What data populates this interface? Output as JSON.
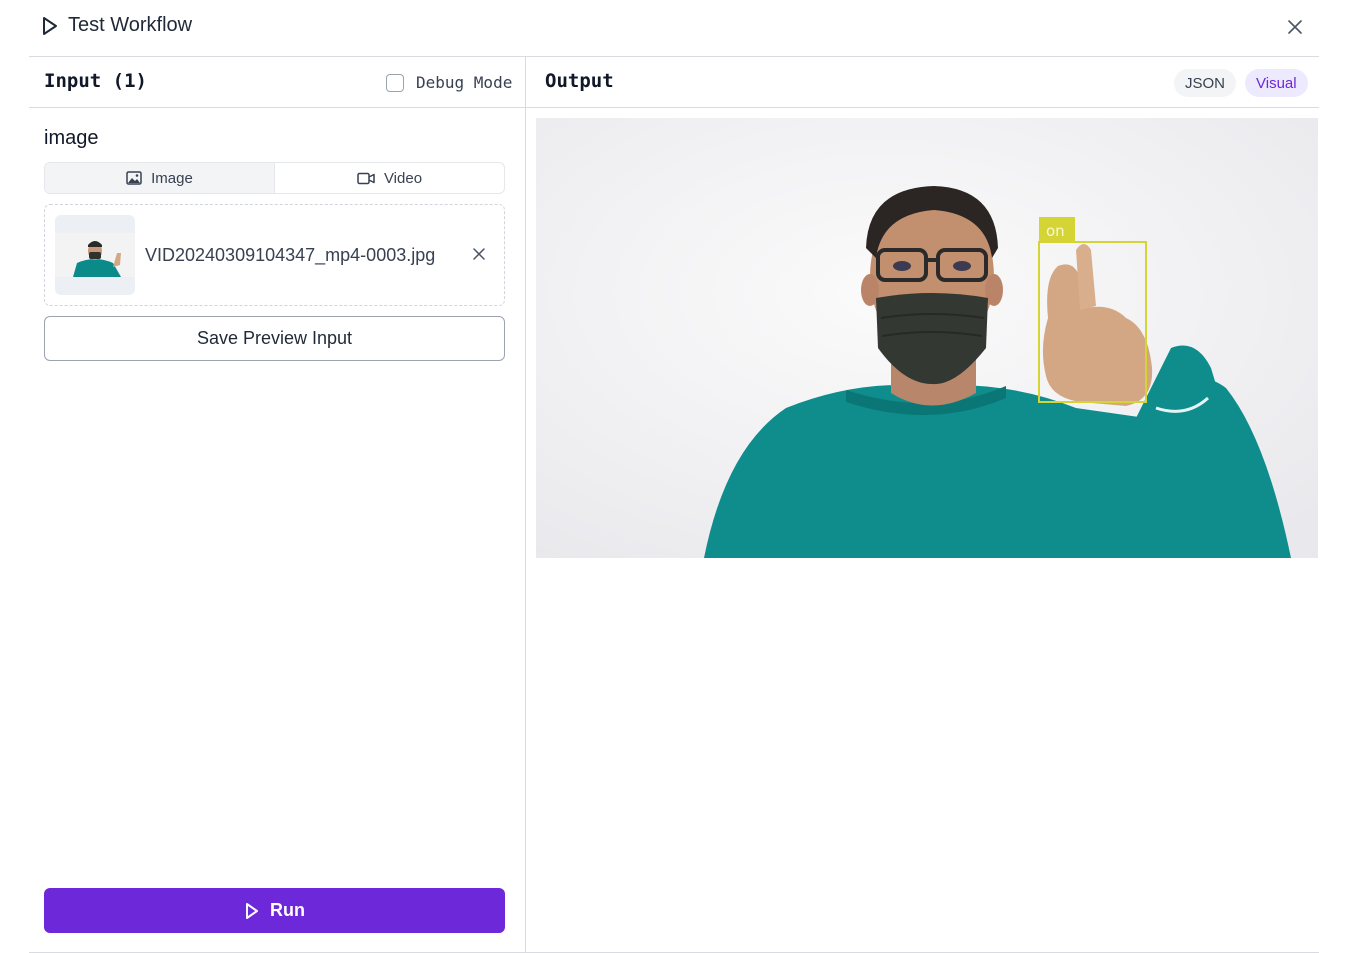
{
  "header": {
    "title": "Test Workflow"
  },
  "input_panel": {
    "title": "Input (1)",
    "debug_mode_label": "Debug Mode",
    "debug_mode_checked": false,
    "field_label": "image",
    "tabs": [
      {
        "label": "Image",
        "icon": "image-icon",
        "active": true
      },
      {
        "label": "Video",
        "icon": "video-icon",
        "active": false
      }
    ],
    "file": {
      "name": "VID20240309104347_mp4-0003.jpg"
    },
    "save_button_label": "Save Preview Input",
    "run_button_label": "Run"
  },
  "output_panel": {
    "title": "Output",
    "view_toggles": [
      {
        "label": "JSON",
        "active": false
      },
      {
        "label": "Visual",
        "active": true
      }
    ],
    "detection": {
      "label": "on",
      "box_color": "#d4d534"
    }
  },
  "colors": {
    "accent": "#6d28d9",
    "accent_light": "#ede9fe",
    "border": "#d9dbe0"
  }
}
